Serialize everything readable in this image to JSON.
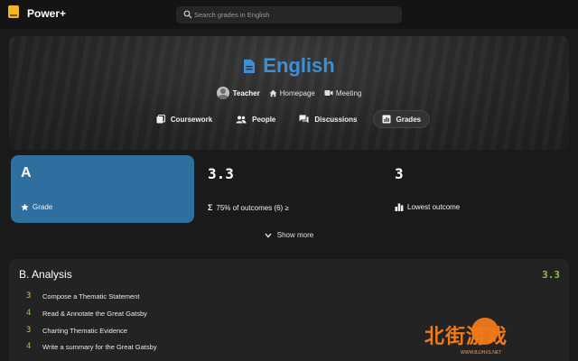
{
  "app": {
    "name": "Power+"
  },
  "search": {
    "placeholder": "Search grades in English"
  },
  "course": {
    "title": "English",
    "teacher": "Teacher",
    "homepage": "Homepage",
    "meeting": "Meeting"
  },
  "tabs": [
    {
      "label": "Coursework",
      "icon": "coursework-icon",
      "active": false
    },
    {
      "label": "People",
      "icon": "people-icon",
      "active": false
    },
    {
      "label": "Discussions",
      "icon": "discussions-icon",
      "active": false
    },
    {
      "label": "Grades",
      "icon": "grades-icon",
      "active": true
    }
  ],
  "stats": [
    {
      "value": "A",
      "label": "Grade",
      "icon": "star-icon"
    },
    {
      "value": "3.3",
      "label": "75% of outcomes (6) ≥",
      "icon": "sigma-icon"
    },
    {
      "value": "3",
      "label": "Lowest outcome",
      "icon": "bar-chart-icon"
    }
  ],
  "show_more": "Show more",
  "analysis": {
    "title": "B. Analysis",
    "score": "3.3",
    "items": [
      {
        "score": "3",
        "label": "Compose a Thematic Statement"
      },
      {
        "score": "4",
        "label": "Read & Annotate the Great Gatsby"
      },
      {
        "score": "3",
        "label": "Charting Thematic Evidence"
      },
      {
        "score": "4",
        "label": "Write a summary for the Great Gatsby"
      }
    ]
  },
  "watermark": {
    "text": "北街游戏",
    "url": "WWW.BJJHXS.NET"
  },
  "colors": {
    "accent": "#3d8fd6",
    "grade_card": "#2f6f9f",
    "score_green": "#8bc34a",
    "score_yellow": "#e8c14a",
    "logo": "#f2b720"
  }
}
